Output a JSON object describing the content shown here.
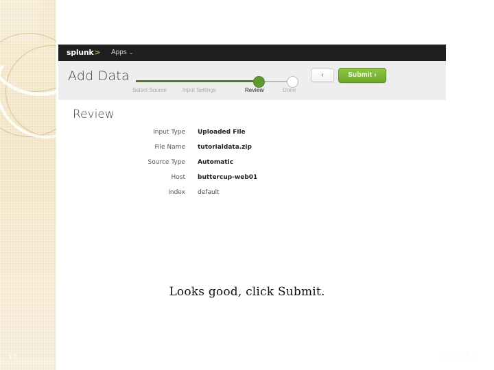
{
  "slide": {
    "page_number": "17",
    "watermark": "splunk>",
    "caption": "Looks good, click Submit."
  },
  "splunk": {
    "logo": "splunk",
    "logo_caret": ">",
    "apps_menu": "Apps",
    "chevron": "⌄",
    "page_title": "Add Data",
    "stepper": {
      "steps": [
        {
          "label": "Select Source",
          "state": "done"
        },
        {
          "label": "Input Settings",
          "state": "done"
        },
        {
          "label": "Review",
          "state": "current"
        },
        {
          "label": "Done",
          "state": "todo"
        }
      ]
    },
    "back_button": "‹",
    "submit_button": "Submit ›",
    "section_title": "Review",
    "fields": [
      {
        "label": "Input Type",
        "value": "Uploaded File",
        "emphasis": "bold"
      },
      {
        "label": "File Name",
        "value": "tutorialdata.zip",
        "emphasis": "bold"
      },
      {
        "label": "Source Type",
        "value": "Automatic",
        "emphasis": "bold"
      },
      {
        "label": "Host",
        "value": "buttercup-web01",
        "emphasis": "bold"
      },
      {
        "label": "Index",
        "value": "default",
        "emphasis": "plain"
      }
    ]
  },
  "colors": {
    "splunk_green": "#8dc63f",
    "stepper_done": "#4f7a2b",
    "topbar": "#1f1f1f",
    "greybar": "#eeeeee",
    "sidebar_beige": "#f0dfbb"
  }
}
